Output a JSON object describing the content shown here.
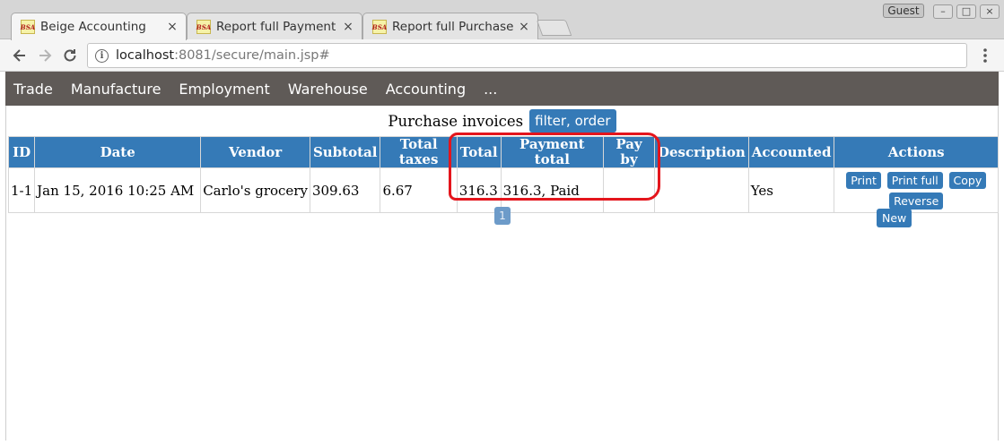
{
  "browser": {
    "tabs": [
      {
        "favicon": "BSA",
        "title": "Beige Accounting",
        "active": true
      },
      {
        "favicon": "BSA",
        "title": "Report full Payment"
      },
      {
        "favicon": "BSA",
        "title": "Report full Purchase"
      }
    ],
    "close_glyph": "×",
    "profile": "Guest",
    "window_buttons": {
      "minimize": "–",
      "maximize": "□",
      "close": "×"
    },
    "address": {
      "host": "localhost",
      "path": ":8081/secure/main.jsp#"
    },
    "icons": {
      "back": "arrow-left-icon",
      "forward": "arrow-right-icon",
      "reload": "reload-icon",
      "info": "info-icon",
      "menu": "kebab-menu-icon"
    }
  },
  "app_menu": {
    "items": [
      "Trade",
      "Manufacture",
      "Employment",
      "Warehouse",
      "Accounting",
      "..."
    ]
  },
  "page": {
    "heading": "Purchase invoices",
    "filter_button": "filter, order",
    "table": {
      "columns": [
        "ID",
        "Date",
        "Vendor",
        "Subtotal",
        "Total taxes",
        "Total",
        "Payment total",
        "Pay by",
        "Description",
        "Accounted",
        "Actions"
      ],
      "rows": [
        {
          "id": "1-1",
          "date": "Jan 15, 2016 10:25 AM",
          "vendor": "Carlo's grocery",
          "subtotal": "309.63",
          "total_taxes": "6.67",
          "total": "316.3",
          "payment_total": "316.3, Paid",
          "pay_by": "",
          "description": "",
          "accounted": "Yes",
          "actions": [
            "Print",
            "Print full",
            "Copy",
            "Reverse"
          ]
        }
      ]
    },
    "pagination": {
      "current_page": "1"
    },
    "new_button": "New"
  },
  "colors": {
    "menu_bg": "#5f5a57",
    "accent_blue": "#357ab7",
    "annotation_red": "#e4151c"
  }
}
